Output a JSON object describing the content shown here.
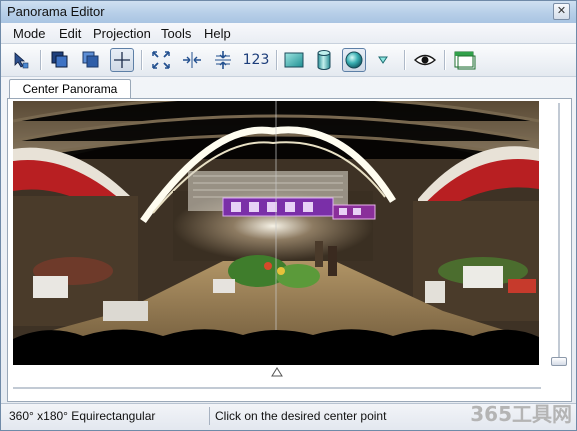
{
  "window": {
    "title": "Panorama Editor"
  },
  "menu": [
    "Mode",
    "Edit",
    "Projection",
    "Tools",
    "Help"
  ],
  "toolbar": {
    "icons": [
      "select-arrow-icon",
      "layers-icon",
      "layers-blue-icon",
      "crosshair-icon",
      "fit-icon",
      "align-horizontal-icon",
      "align-vertical-icon",
      "number-label-icon",
      "rectilinear-icon",
      "cylinder-icon",
      "sphere-icon",
      "dropdown-triangle-icon",
      "eye-icon",
      "window-icon"
    ],
    "number_label": "123",
    "active_tool": "crosshair-icon",
    "active_projection": "sphere-icon"
  },
  "tab": {
    "label": "Center Panorama"
  },
  "status": {
    "projection": "360° x180° Equirectangular",
    "hint": "Click on the desired center point"
  },
  "watermark": "365工具网",
  "colors": {
    "accent": "#5d7fa6",
    "sign_purple": "#7a2fa8",
    "toolbar_blue": "#1c3d7a"
  }
}
